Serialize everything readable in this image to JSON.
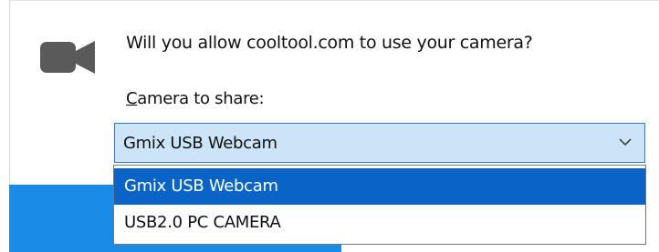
{
  "prompt": {
    "text": "Will you allow cooltool.com to use your camera?"
  },
  "camera_label": {
    "accesskey": "C",
    "rest": "amera to share:"
  },
  "camera_select": {
    "selected": "Gmix USB Webcam",
    "options": [
      "Gmix USB Webcam",
      "USB2.0 PC CAMERA"
    ]
  },
  "icons": {
    "camera": "video-camera-icon",
    "dropdown": "chevron-down-icon"
  },
  "colors": {
    "select_bg": "#cce4f7",
    "select_border": "#2a7ad1",
    "highlight": "#0a64c8",
    "button_blue": "#1a8ce8",
    "icon_gray": "#5a5a5a"
  }
}
